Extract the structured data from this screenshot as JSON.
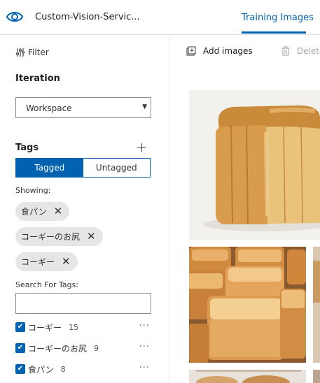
{
  "header": {
    "project_name": "Custom-Vision-Servic...",
    "nav_tab": "Training Images",
    "icons": {
      "logo": "eye-icon"
    }
  },
  "sidebar": {
    "filter_label": "Filter",
    "iteration_title": "Iteration",
    "iteration_value": "Workspace",
    "tags_title": "Tags",
    "toggle": {
      "tagged": "Tagged",
      "untagged": "Untagged",
      "selected": "Tagged"
    },
    "showing_label": "Showing:",
    "showing_chips": [
      {
        "label": "食パン"
      },
      {
        "label": "コーギーのお尻"
      },
      {
        "label": "コーギー"
      }
    ],
    "search_label": "Search For Tags:",
    "search_value": "",
    "tags": [
      {
        "name": "コーギー",
        "count": "15",
        "checked": true
      },
      {
        "name": "コーギーのお尻",
        "count": "9",
        "checked": true
      },
      {
        "name": "食パン",
        "count": "8",
        "checked": true
      }
    ]
  },
  "toolbar": {
    "add_images": "Add images",
    "delete": "Delete"
  },
  "colors": {
    "accent": "#0062b1",
    "chip_bg": "#e6e6e6"
  }
}
